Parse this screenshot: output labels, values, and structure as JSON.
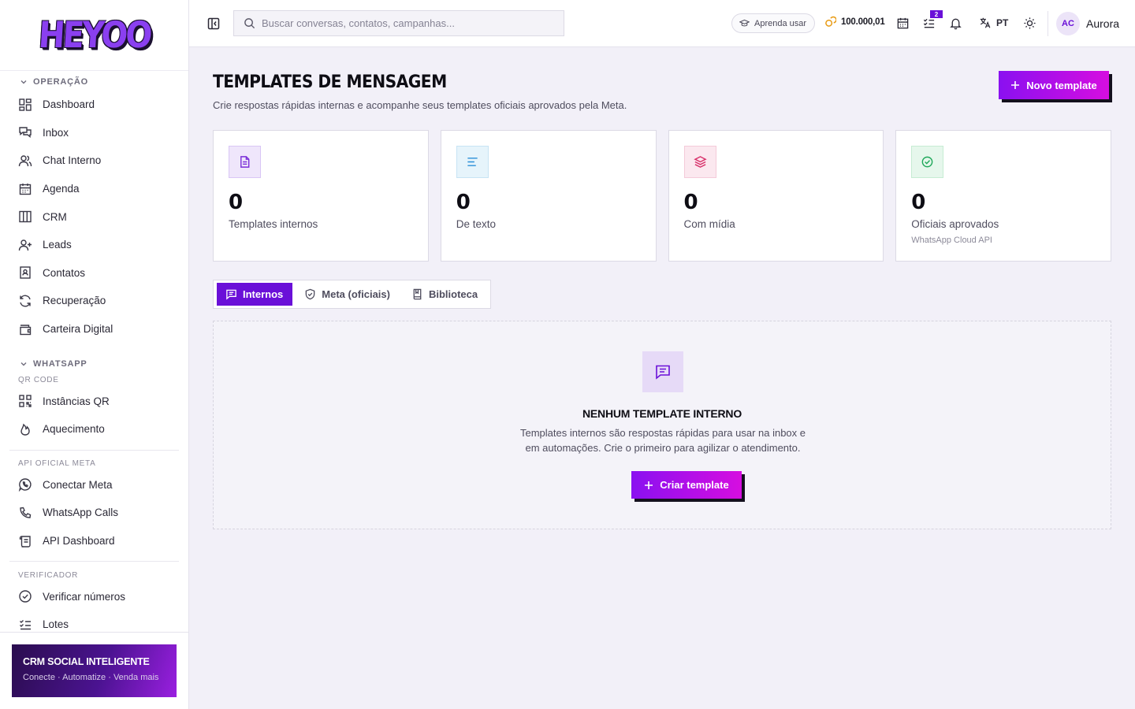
{
  "brand": {
    "logo_text": "HEYOO",
    "accent": "#6a10d8",
    "gradient_start": "#8a10f0",
    "gradient_end": "#d60ee0"
  },
  "sidebar": {
    "sections": [
      {
        "title": "OPERAÇÃO",
        "items": [
          "Dashboard",
          "Inbox",
          "Chat Interno",
          "Agenda",
          "CRM",
          "Leads",
          "Contatos",
          "Recuperação",
          "Carteira Digital"
        ]
      },
      {
        "title": "WHATSAPP",
        "sub1": "QR CODE",
        "items1": [
          "Instâncias QR",
          "Aquecimento"
        ],
        "sub2": "API OFICIAL META",
        "items2": [
          "Conectar Meta",
          "WhatsApp Calls",
          "API Dashboard"
        ],
        "sub3": "VERIFICADOR",
        "items3": [
          "Verificar números",
          "Lotes"
        ]
      }
    ],
    "promo": {
      "title": "CRM SOCIAL INTELIGENTE",
      "subtitle": "Conecte · Automatize · Venda mais"
    }
  },
  "topbar": {
    "search_placeholder": "Buscar conversas, contatos, campanhas...",
    "learn_label": "Aprenda usar",
    "coins": "100.000,01",
    "tasks_badge": "2",
    "language": "PT",
    "user_initials": "AC",
    "user_name": "Aurora"
  },
  "page": {
    "title": "TEMPLATES DE MENSAGEM",
    "subtitle": "Crie respostas rápidas internas e acompanhe seus templates oficiais aprovados pela Meta.",
    "new_button": "Novo template"
  },
  "stats": [
    {
      "value": "0",
      "label": "Templates internos",
      "icon": "file-text-icon",
      "color": "#7b2fd8",
      "bg": "#efe6fb",
      "note": ""
    },
    {
      "value": "0",
      "label": "De texto",
      "icon": "align-left-icon",
      "color": "#2a8fd8",
      "bg": "#e6f4fb",
      "note": ""
    },
    {
      "value": "0",
      "label": "Com mídia",
      "icon": "layers-icon",
      "color": "#d8306a",
      "bg": "#fbe8ef",
      "note": ""
    },
    {
      "value": "0",
      "label": "Oficiais aprovados",
      "icon": "check-circle-icon",
      "color": "#1fa85a",
      "bg": "#e6f7ec",
      "note": "WhatsApp Cloud API"
    }
  ],
  "tabs": [
    {
      "label": "Internos",
      "active": true
    },
    {
      "label": "Meta (oficiais)",
      "active": false
    },
    {
      "label": "Biblioteca",
      "active": false
    }
  ],
  "empty": {
    "title": "NENHUM TEMPLATE INTERNO",
    "description": "Templates internos são respostas rápidas para usar na inbox e em automações. Crie o primeiro para agilizar o atendimento.",
    "button": "Criar template"
  }
}
